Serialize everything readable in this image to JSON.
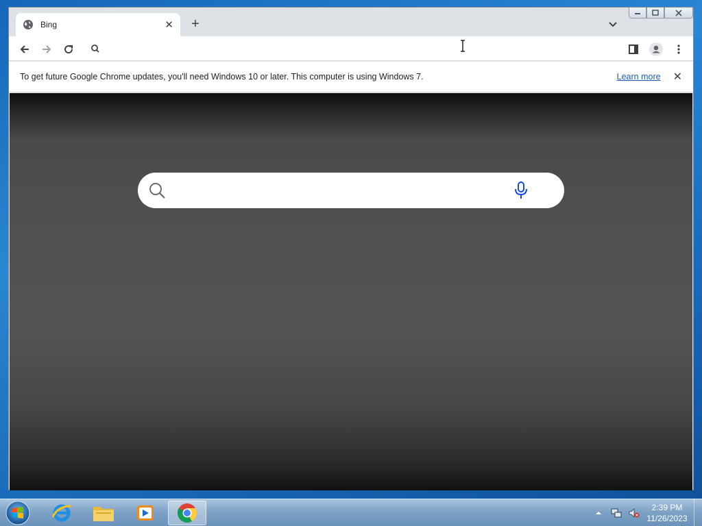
{
  "browser": {
    "tab": {
      "title": "Bing",
      "favicon": "globe-icon"
    },
    "address_bar": {
      "value": "",
      "placeholder": ""
    },
    "infobar": {
      "message": "To get future Google Chrome updates, you'll need Windows 10 or later. This computer is using Windows 7.",
      "link_label": "Learn more"
    }
  },
  "page": {
    "search_box": {
      "value": "",
      "placeholder": ""
    }
  },
  "taskbar": {
    "apps": [
      "windows-start-icon",
      "internet-explorer-icon",
      "file-explorer-icon",
      "media-player-icon",
      "chrome-icon"
    ],
    "clock": {
      "time": "2:39 PM",
      "date": "11/26/2023"
    }
  },
  "colors": {
    "chrome_frame": "#dee1e6",
    "infobar_link": "#1a5fb4",
    "bing_mic": "#174ae4",
    "taskbar": "#7fa3c7"
  }
}
